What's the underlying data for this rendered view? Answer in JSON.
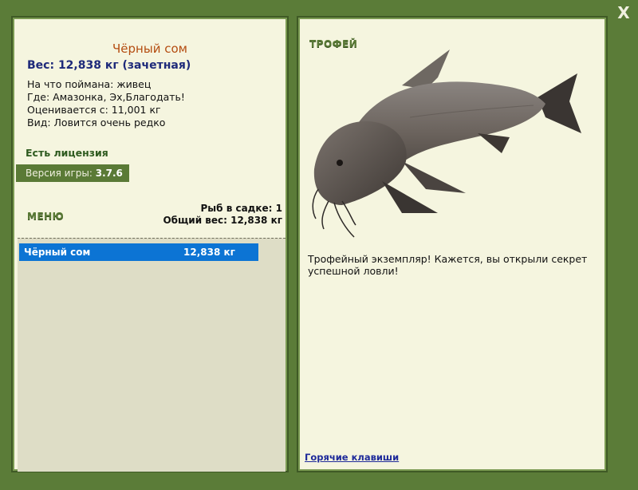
{
  "close_label": "X",
  "fish": {
    "name": "Чёрный сом",
    "weight_line": "Вес: 12,838 кг (зачетная)",
    "caught_on": "На что поймана: живец",
    "where": "Где: Амазонка, Эх,Благодать!",
    "valued_from": "Оценивается с: 11,001 кг",
    "rarity": "Вид: Ловится очень редко"
  },
  "license": "Есть лицензия",
  "version": {
    "label": "Версия игры:",
    "value": "3.7.6"
  },
  "menu_label": "МЕНЮ",
  "keepnet": {
    "count": "Рыб в садке: 1",
    "total": "Общий вес: 12,838 кг"
  },
  "catch_list": [
    {
      "name": "Чёрный сом",
      "weight": "12,838 кг"
    }
  ],
  "trophy": {
    "title": "ТРОФЕЙ",
    "text": "Трофейный экземпляр! Кажется, вы открыли секрет успешной ловли!"
  },
  "hotkeys_label": "Горячие клавиши",
  "colors": {
    "frame": "#5b7c38",
    "panel": "#f5f5df",
    "highlight": "#0c74d4",
    "fish_name": "#b44c10"
  }
}
